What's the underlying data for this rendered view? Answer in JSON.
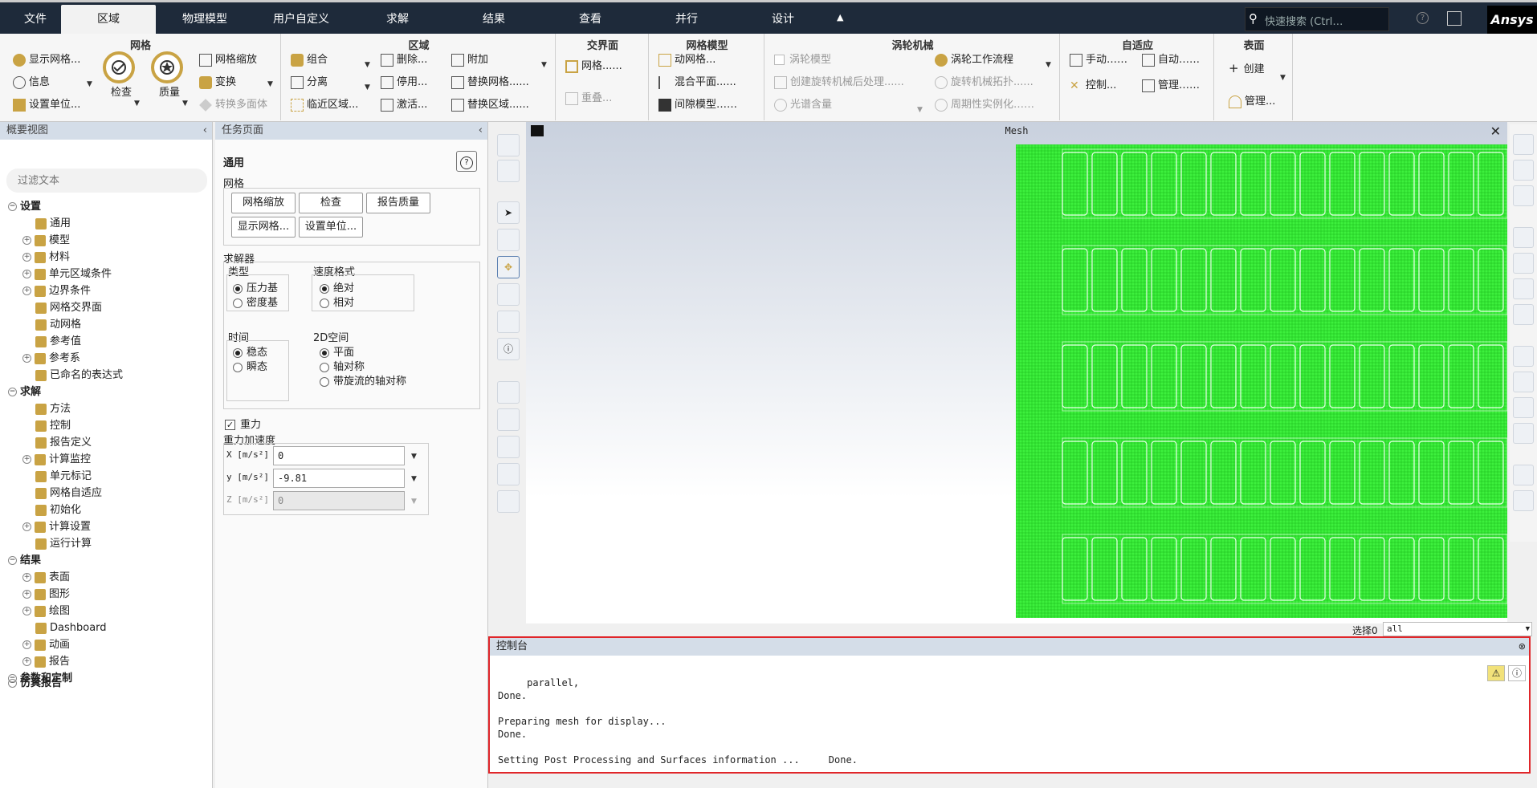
{
  "menubar": {
    "tabs": [
      "文件",
      "区域",
      "物理模型",
      "用户自定义",
      "求解",
      "结果",
      "查看",
      "并行",
      "设计"
    ],
    "active": "区域",
    "search_placeholder": "快速搜索 (Ctrl…",
    "logo": "Ansys"
  },
  "ribbon": {
    "mesh": {
      "title": "网格",
      "display": "显示网格...",
      "info": "信息",
      "units": "设置单位...",
      "scale": "网格缩放",
      "check": "检查",
      "quality": "质量",
      "transform": "变换",
      "convert": "转换多面体"
    },
    "zone": {
      "title": "区域",
      "combine": "组合",
      "separate": "分离",
      "adjacency": "临近区域...",
      "delete": "删除...",
      "deactivate": "停用...",
      "activate": "激活...",
      "append": "附加",
      "replace_mesh": "替换网格......",
      "replace_zone": "替换区域......"
    },
    "interface": {
      "title": "交界面",
      "mesh": "网格......",
      "overlap": "重叠..."
    },
    "mesh_models": {
      "title": "网格模型",
      "dynamic": "动网格...",
      "mixing": "混合平面......",
      "gap": "间隙模型……"
    },
    "turbo": {
      "title": "涡轮机械",
      "model": "涡轮模型",
      "post": "创建旋转机械后处理......",
      "spectral": "光谱含量",
      "workflow": "涡轮工作流程",
      "topology": "旋转机械拓扑......",
      "periodic": "周期性实例化……"
    },
    "adapt": {
      "title": "自适应",
      "manual": "手动……",
      "auto": "自动……",
      "control": "控制...",
      "manage": "管理……"
    },
    "surface": {
      "title": "表面",
      "create": "创建",
      "manage": "管理..."
    }
  },
  "outline": {
    "title": "概要视图",
    "filter_placeholder": "过滤文本",
    "items": [
      "设置",
      "通用",
      "模型",
      "材料",
      "单元区域条件",
      "边界条件",
      "网格交界面",
      "动网格",
      "参考值",
      "参考系",
      "已命名的表达式",
      "求解",
      "方法",
      "控制",
      "报告定义",
      "计算监控",
      "单元标记",
      "网格自适应",
      "初始化",
      "计算设置",
      "运行计算",
      "结果",
      "表面",
      "图形",
      "绘图",
      "Dashboard",
      "动画",
      "报告",
      "参数和定制",
      "仿真报告"
    ]
  },
  "task": {
    "title": "任务页面",
    "section": "通用",
    "mesh_label": "网格",
    "btn_scale": "网格缩放",
    "btn_check": "检查",
    "btn_quality": "报告质量",
    "btn_display": "显示网格...",
    "btn_units": "设置单位...",
    "solver_label": "求解器",
    "type_label": "类型",
    "pressure": "压力基",
    "density": "密度基",
    "velocity_label": "速度格式",
    "absolute": "绝对",
    "relative": "相对",
    "time_label": "时间",
    "steady": "稳态",
    "transient": "瞬态",
    "space_label": "2D空间",
    "planar": "平面",
    "axisym": "轴对称",
    "axisym_swirl": "带旋流的轴对称",
    "gravity": "重力",
    "gravity_accel": "重力加速度",
    "x_label": "X [m/s²]",
    "x_val": "0",
    "y_label": "y [m/s²]",
    "y_val": "-9.81",
    "z_label": "Z [m/s²]",
    "z_val": "0"
  },
  "graphics": {
    "title": "Mesh",
    "select_label": "选择0",
    "select_value": "all"
  },
  "console": {
    "title": "控制台",
    "text": "     parallel,\nDone.\n\nPreparing mesh for display...\nDone.\n\nSetting Post Processing and Surfaces information ...     Done."
  },
  "colors": {
    "menubar": "#1e2a3a",
    "mesh": "#22ee22",
    "highlight": "#e0262a"
  }
}
